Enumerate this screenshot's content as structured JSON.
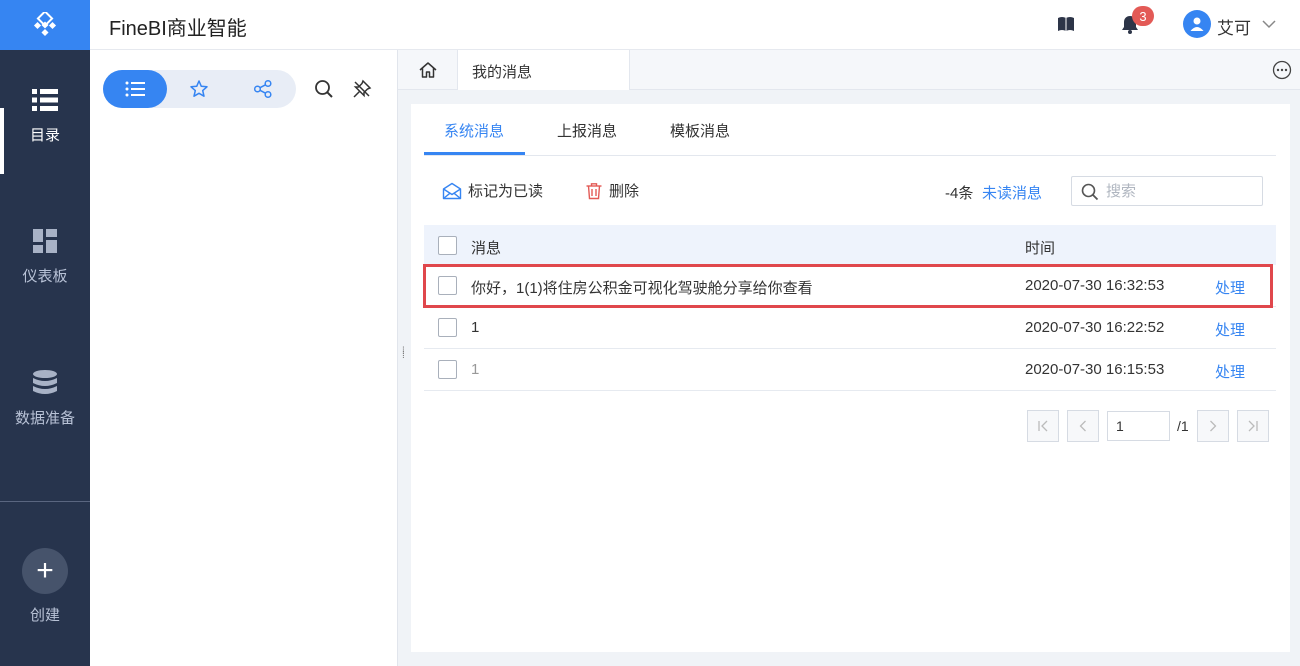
{
  "app": {
    "title": "FineBI商业智能"
  },
  "nav": {
    "items": [
      {
        "label": "目录",
        "icon": "list-icon",
        "active": true
      },
      {
        "label": "仪表板",
        "icon": "dashboard-icon",
        "active": false
      },
      {
        "label": "数据准备",
        "icon": "database-icon",
        "active": false
      }
    ],
    "create_label": "创建"
  },
  "topbar": {
    "notification_count": "3",
    "user_name": "艾可"
  },
  "directory": {
    "segments": [
      "list-icon",
      "star-icon",
      "share-icon"
    ],
    "active_segment": 0
  },
  "tabs": {
    "home_icon": "home-icon",
    "current_tab": "我的消息"
  },
  "messages": {
    "subtabs": [
      "系统消息",
      "上报消息",
      "模板消息"
    ],
    "active_subtab": 0,
    "toolbar": {
      "mark_read": "标记为已读",
      "delete": "删除",
      "unread_count": "-4条",
      "unread_link": "未读消息",
      "search_placeholder": "搜索"
    },
    "columns": {
      "message": "消息",
      "time": "时间"
    },
    "rows": [
      {
        "message": "你好，1(1)将住房公积金可视化驾驶舱分享给你查看",
        "time": "2020-07-30 16:32:53",
        "action": "处理"
      },
      {
        "message": "1",
        "time": "2020-07-30 16:22:52",
        "action": "处理"
      },
      {
        "message": "1",
        "time": "2020-07-30 16:15:53",
        "action": "处理"
      }
    ],
    "pagination": {
      "page": "1",
      "total": "/1"
    }
  },
  "colors": {
    "accent": "#3685f2",
    "nav_bg": "#27344d",
    "badge": "#e35a56",
    "highlight": "#e0474c"
  }
}
